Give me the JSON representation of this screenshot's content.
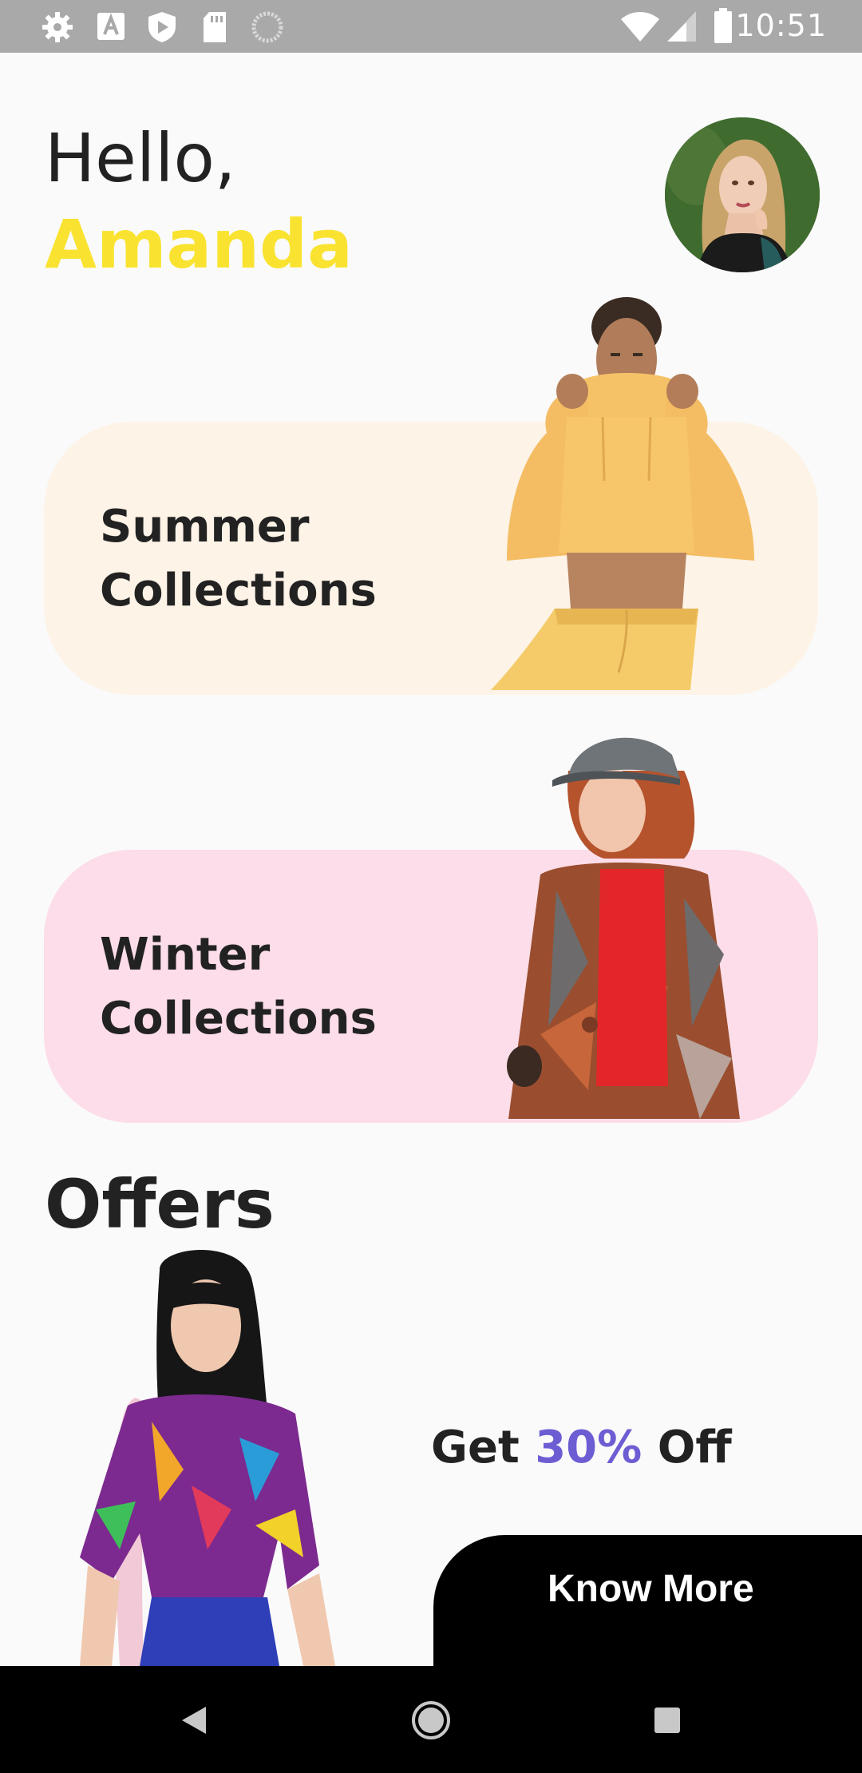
{
  "status_bar": {
    "time": "10:51",
    "left_icons": [
      "gear-icon",
      "font-a-icon",
      "shield-play-icon",
      "sd-card-icon",
      "circle-loading-icon"
    ],
    "right_icons": [
      "wifi-icon",
      "signal-icon",
      "battery-icon"
    ]
  },
  "greeting": {
    "hello": "Hello,",
    "name": "Amanda",
    "name_color": "#f9e330"
  },
  "collections": [
    {
      "label": "Summer\nCollections",
      "background": "#fdf3e7"
    },
    {
      "label": "Winter\nCollections",
      "background": "#fcdde9"
    }
  ],
  "offers": {
    "heading": "Offers",
    "get_text": "Get",
    "percent": "30%",
    "off_text": "Off",
    "percent_color": "#6c5dd3",
    "button_label": "Know More"
  },
  "nav_bar": {
    "buttons": [
      "back-icon",
      "home-icon",
      "recents-icon"
    ]
  }
}
